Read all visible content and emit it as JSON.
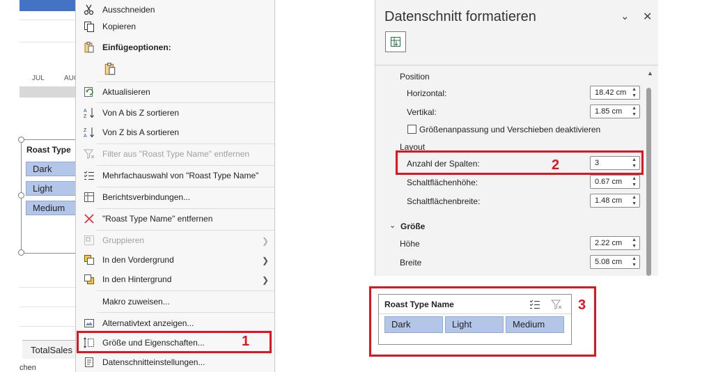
{
  "excel": {
    "months": [
      "JUL",
      "AUG"
    ],
    "slicer_title": "Roast Type",
    "slicer_items": [
      "Dark",
      "Light",
      "Medium"
    ],
    "sheet_tab": "TotalSales",
    "status_fragment": "chen"
  },
  "context_menu": {
    "items": [
      {
        "label": "Ausschneiden",
        "icon": "scissors-icon"
      },
      {
        "label": "Kopieren",
        "icon": "copy-icon"
      },
      {
        "label": "Einfügeoptionen:",
        "icon": "paste-options-icon"
      },
      {
        "label": "Aktualisieren",
        "icon": "refresh-icon"
      },
      {
        "label": "Von A bis Z sortieren",
        "icon": "sort-az-icon"
      },
      {
        "label": "Von Z bis A sortieren",
        "icon": "sort-za-icon"
      },
      {
        "label": "Filter aus \"Roast Type Name\" entfernen",
        "icon": "clear-filter-icon",
        "disabled": true
      },
      {
        "label": "Mehrfachauswahl von \"Roast Type Name\"",
        "icon": "multi-select-icon"
      },
      {
        "label": "Berichtsverbindungen...",
        "icon": "report-connections-icon"
      },
      {
        "label": "\"Roast Type Name\" entfernen",
        "icon": "remove-x-icon"
      },
      {
        "label": "Gruppieren",
        "icon": "group-icon",
        "disabled": true
      },
      {
        "label": "In den Vordergrund",
        "icon": "bring-forward-icon"
      },
      {
        "label": "In den Hintergrund",
        "icon": "send-backward-icon"
      },
      {
        "label": "Makro zuweisen...",
        "icon": ""
      },
      {
        "label": "Alternativtext anzeigen...",
        "icon": "alt-text-icon"
      },
      {
        "label": "Größe und Eigenschaften...",
        "icon": "size-properties-icon"
      },
      {
        "label": "Datenschnitteinstellungen...",
        "icon": "slicer-settings-icon"
      }
    ]
  },
  "format_pane": {
    "title": "Datenschnitt formatieren",
    "position_header": "Position",
    "horizontal_label": "Horizontal:",
    "horizontal_value": "18.42 cm",
    "vertical_label": "Vertikal:",
    "vertical_value": "1.85 cm",
    "checkbox_label": "Größenanpassung und Verschieben deaktivieren",
    "layout_header": "Layout",
    "columns_label": "Anzahl der Spalten:",
    "columns_value": "3",
    "button_height_label": "Schaltflächenhöhe:",
    "button_height_value": "0.67 cm",
    "button_width_label": "Schaltflächenbreite:",
    "button_width_value": "1.48 cm",
    "size_header": "Größe",
    "height_label": "Höhe",
    "height_value": "2.22 cm",
    "width_label": "Breite",
    "width_value": "5.08 cm"
  },
  "slicer": {
    "title": "Roast Type Name",
    "items": [
      "Dark",
      "Light",
      "Medium"
    ]
  },
  "annotations": [
    "1",
    "2",
    "3"
  ],
  "colors": {
    "accent_red": "#e5131d",
    "slicer_fill": "#b4c6e7",
    "excel_blue": "#4472c4"
  }
}
